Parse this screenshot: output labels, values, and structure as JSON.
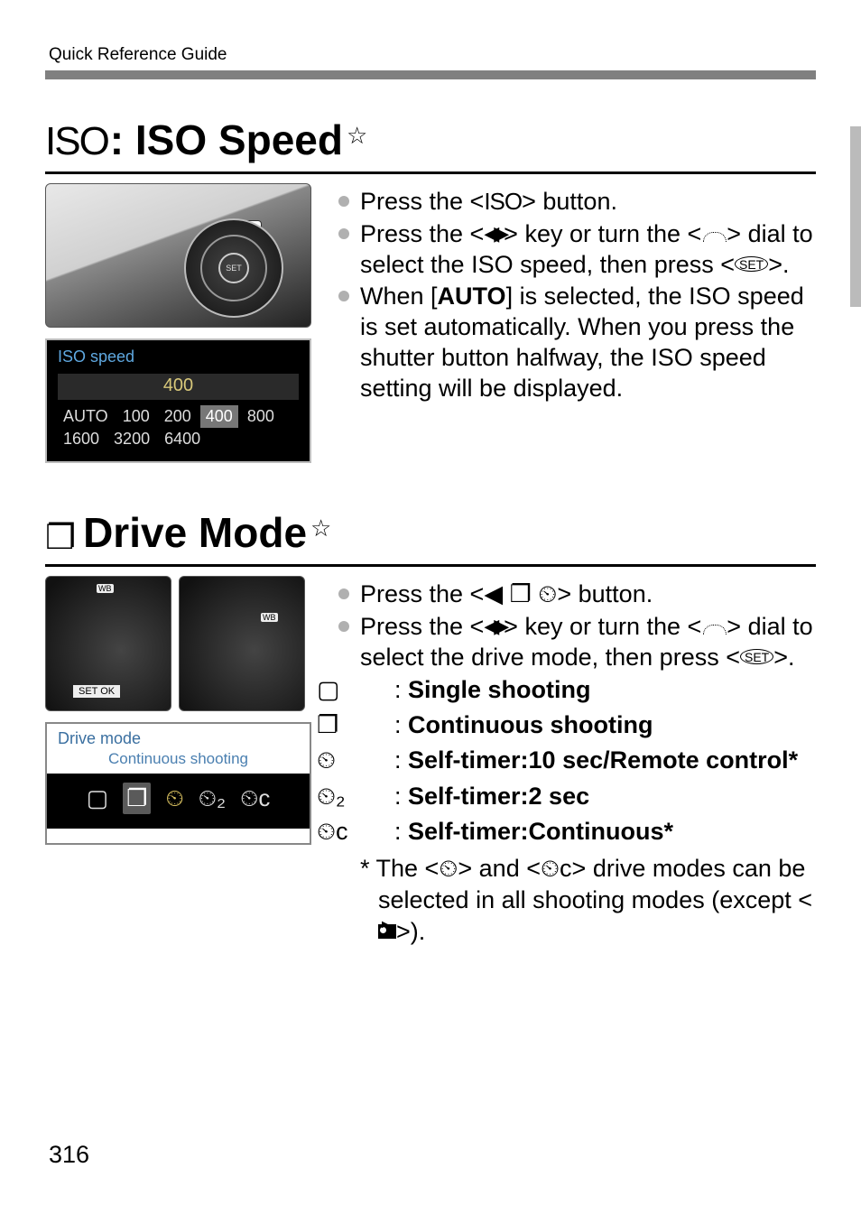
{
  "breadcrumb": "Quick Reference Guide",
  "page_number": "316",
  "iso_section": {
    "prefix_glyph": "ISO",
    "title": ": ISO Speed",
    "star": "☆",
    "lcd": {
      "title": "ISO speed",
      "current": "400",
      "options_row1": [
        "AUTO",
        "100",
        "200",
        "400",
        "800"
      ],
      "options_row2": [
        "1600",
        "3200",
        "6400"
      ],
      "selected": "400"
    },
    "bullets": {
      "b1_pre": "Press the <",
      "b1_glyph": "ISO",
      "b1_post": "> button.",
      "b2_pre": "Press the <",
      "b2_mid": "> key or turn the <",
      "b2_post": "> dial to select the ISO speed, then press <",
      "b2_end": ">.",
      "b3_pre": "When [",
      "b3_auto": "AUTO",
      "b3_post": "] is selected, the ISO speed is set automatically. When you press the shutter button halfway, the ISO speed setting will be displayed."
    }
  },
  "drive_section": {
    "prefix_glyph": "❐",
    "title": " Drive Mode",
    "star": "☆",
    "lcd2": {
      "title": "Drive mode",
      "current": "Continuous shooting"
    },
    "bullets": {
      "b1_pre": "Press the <",
      "b1_glyphs": "◀ ❐ ⏲",
      "b1_post": "> button.",
      "b2_pre": "Press the <",
      "b2_mid": "> key or turn the <",
      "b2_post": "> dial to select the drive mode, then press <",
      "b2_end": ">."
    },
    "modes": {
      "single_glyph": "▢",
      "single_label": "Single shooting",
      "cont_glyph": "❐",
      "cont_label": "Continuous shooting",
      "t10_glyph": "⏲",
      "t10_label": "Self-timer:10 sec/Remote control*",
      "t2_glyph": "⏲₂",
      "t2_label": "Self-timer:2 sec",
      "tc_glyph": "⏲c",
      "tc_label": "Self-timer:Continuous*"
    },
    "note_pre": "* The <",
    "note_g1": "⏲",
    "note_mid": "> and <",
    "note_g2": "⏲c",
    "note_post1": "> drive modes can be selected in all shooting modes (except <",
    "note_post2": ">).",
    "set_label": "SET",
    "ok_label": "SET  OK"
  }
}
